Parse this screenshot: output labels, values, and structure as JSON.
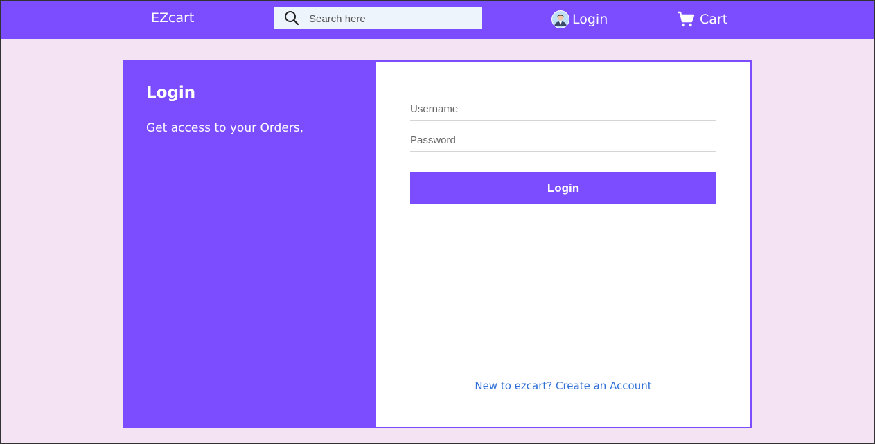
{
  "navbar": {
    "brand": "EZcart",
    "search": {
      "placeholder": "Search here",
      "icon": "search-icon"
    },
    "login_label": "Login",
    "cart_label": "Cart",
    "accent_color": "#7c4dff"
  },
  "login_panel": {
    "title": "Login",
    "subtitle": "Get access to your Orders,"
  },
  "form": {
    "username_placeholder": "Username",
    "password_placeholder": "Password",
    "submit_label": "Login",
    "signup_link": "New to ezcart? Create an Account"
  },
  "colors": {
    "page_background": "#f3e3f3",
    "accent": "#7c4dff",
    "link": "#2f6fd6"
  }
}
